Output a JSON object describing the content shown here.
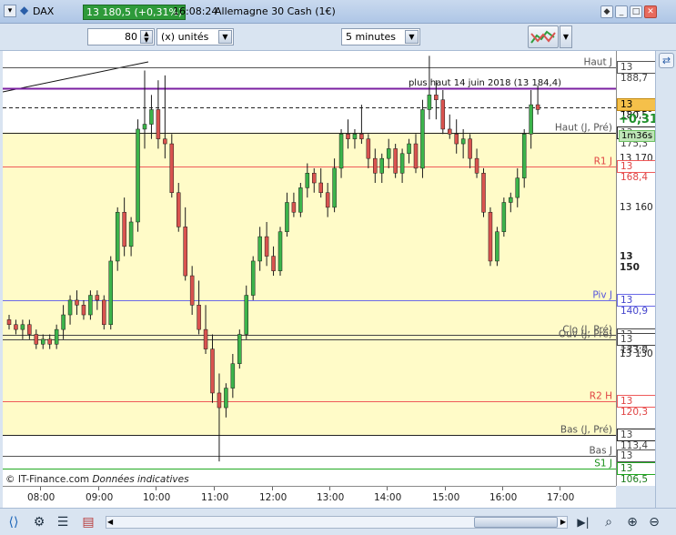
{
  "titlebar": {
    "symbol": "DAX",
    "price_change": "13 180,5 (+0,31%)",
    "time": "16:08:24",
    "instrument": "Allemagne 30 Cash (1€)"
  },
  "toolbar": {
    "units_value": "80",
    "units_label": "(x) unités",
    "timeframe": "5 minutes"
  },
  "chart": {
    "high_note": "plus haut 14 juin 2018 (13 184,4)",
    "source": "© IT-Finance.com",
    "disclaimer": "Données indicatives",
    "lines": [
      {
        "label": "Haut J",
        "value": 13188.7,
        "box": "13 188,7",
        "color": "#555555",
        "text_color": "#555555"
      },
      {
        "label": "",
        "value": 13184.4,
        "box": "",
        "color": "#7b1fa2",
        "text_color": "#7b1fa2"
      },
      {
        "label": "Haut (J, Pré)",
        "value": 13175.3,
        "box": "13 175,3",
        "color": "#222222",
        "text_color": "#555555"
      },
      {
        "label": "R1 J",
        "value": 13168.4,
        "box": "13 168,4",
        "color": "#ef5a5a",
        "text_color": "#e04444"
      },
      {
        "label": "Piv J",
        "value": 13140.9,
        "box": "13 140,9",
        "color": "#6a6ae8",
        "text_color": "#5555dd"
      },
      {
        "label": "Clo (J, Pré)",
        "value": 13134.0,
        "box": "13 134,0",
        "color": "#444444",
        "text_color": "#555555"
      },
      {
        "label": "Ouv (J, Pré)",
        "value": 13133.0,
        "box": "13 133,0",
        "color": "#444444",
        "text_color": "#555555"
      },
      {
        "label": "R2 H",
        "value": 13120.3,
        "box": "13 120,3",
        "color": "#ef5a5a",
        "text_color": "#e04444"
      },
      {
        "label": "Bas (J, Pré)",
        "value": 13113.4,
        "box": "13 113,4",
        "color": "#222222",
        "text_color": "#555555"
      },
      {
        "label": "Bas J",
        "value": 13109.2,
        "box": "13 109,2",
        "color": "#555555",
        "text_color": "#555555"
      },
      {
        "label": "S1 J",
        "value": 13106.5,
        "box": "13 106,5",
        "color": "#22aa22",
        "text_color": "#1a8f1a"
      }
    ],
    "current_price_box": "13 180,5",
    "change_pct": "+0,31%",
    "countdown": "1m36s",
    "y_ticks": [
      "13 180",
      "13 170",
      "13 160",
      "13 150",
      "13 130"
    ],
    "x_ticks": [
      "08:00",
      "09:00",
      "10:00",
      "11:00",
      "12:00",
      "13:00",
      "14:00",
      "15:00",
      "16:00",
      "17:00"
    ],
    "colors": {
      "up": "#3cb44b",
      "down": "#d9534f",
      "session_bg": "#fffbc8",
      "current_price": "#f5c04a"
    }
  },
  "chart_data": {
    "type": "candlestick",
    "y_range": [
      13103,
      13192
    ],
    "x_ticks": [
      "08:00",
      "09:00",
      "10:00",
      "11:00",
      "12:00",
      "13:00",
      "14:00",
      "15:00",
      "16:00",
      "17:00"
    ],
    "candles": [
      {
        "o": 13137,
        "h": 13138,
        "l": 13135,
        "c": 13136
      },
      {
        "o": 13136,
        "h": 13137,
        "l": 13134,
        "c": 13135
      },
      {
        "o": 13135,
        "h": 13137,
        "l": 13133,
        "c": 13136
      },
      {
        "o": 13136,
        "h": 13137,
        "l": 13133,
        "c": 13134
      },
      {
        "o": 13134,
        "h": 13135,
        "l": 13131,
        "c": 13132
      },
      {
        "o": 13132,
        "h": 13134,
        "l": 13131,
        "c": 13133
      },
      {
        "o": 13133,
        "h": 13134,
        "l": 13131,
        "c": 13132
      },
      {
        "o": 13132,
        "h": 13136,
        "l": 13131,
        "c": 13135
      },
      {
        "o": 13135,
        "h": 13140,
        "l": 13133,
        "c": 13138
      },
      {
        "o": 13138,
        "h": 13142,
        "l": 13136,
        "c": 13141
      },
      {
        "o": 13141,
        "h": 13143,
        "l": 13138,
        "c": 13140
      },
      {
        "o": 13140,
        "h": 13141,
        "l": 13137,
        "c": 13138
      },
      {
        "o": 13138,
        "h": 13143,
        "l": 13137,
        "c": 13142
      },
      {
        "o": 13142,
        "h": 13143,
        "l": 13139,
        "c": 13141
      },
      {
        "o": 13141,
        "h": 13142,
        "l": 13135,
        "c": 13136
      },
      {
        "o": 13136,
        "h": 13150,
        "l": 13135,
        "c": 13149
      },
      {
        "o": 13149,
        "h": 13160,
        "l": 13147,
        "c": 13159
      },
      {
        "o": 13159,
        "h": 13162,
        "l": 13150,
        "c": 13152
      },
      {
        "o": 13152,
        "h": 13158,
        "l": 13150,
        "c": 13157
      },
      {
        "o": 13157,
        "h": 13178,
        "l": 13155,
        "c": 13176
      },
      {
        "o": 13176,
        "h": 13188,
        "l": 13172,
        "c": 13177
      },
      {
        "o": 13177,
        "h": 13183,
        "l": 13174,
        "c": 13180
      },
      {
        "o": 13180,
        "h": 13186,
        "l": 13172,
        "c": 13174
      },
      {
        "o": 13174,
        "h": 13187,
        "l": 13170,
        "c": 13173
      },
      {
        "o": 13173,
        "h": 13175,
        "l": 13162,
        "c": 13163
      },
      {
        "o": 13163,
        "h": 13165,
        "l": 13155,
        "c": 13156
      },
      {
        "o": 13156,
        "h": 13160,
        "l": 13145,
        "c": 13146
      },
      {
        "o": 13146,
        "h": 13148,
        "l": 13138,
        "c": 13140
      },
      {
        "o": 13140,
        "h": 13145,
        "l": 13134,
        "c": 13135
      },
      {
        "o": 13135,
        "h": 13140,
        "l": 13130,
        "c": 13131
      },
      {
        "o": 13131,
        "h": 13134,
        "l": 13120,
        "c": 13122
      },
      {
        "o": 13122,
        "h": 13126,
        "l": 13108,
        "c": 13119
      },
      {
        "o": 13119,
        "h": 13124,
        "l": 13117,
        "c": 13123
      },
      {
        "o": 13123,
        "h": 13130,
        "l": 13121,
        "c": 13128
      },
      {
        "o": 13128,
        "h": 13135,
        "l": 13127,
        "c": 13134
      },
      {
        "o": 13134,
        "h": 13144,
        "l": 13133,
        "c": 13142
      },
      {
        "o": 13142,
        "h": 13150,
        "l": 13141,
        "c": 13149
      },
      {
        "o": 13149,
        "h": 13156,
        "l": 13147,
        "c": 13154
      },
      {
        "o": 13154,
        "h": 13157,
        "l": 13148,
        "c": 13150
      },
      {
        "o": 13150,
        "h": 13152,
        "l": 13146,
        "c": 13147
      },
      {
        "o": 13147,
        "h": 13156,
        "l": 13146,
        "c": 13155
      },
      {
        "o": 13155,
        "h": 13163,
        "l": 13154,
        "c": 13161
      },
      {
        "o": 13161,
        "h": 13163,
        "l": 13158,
        "c": 13159
      },
      {
        "o": 13159,
        "h": 13165,
        "l": 13158,
        "c": 13164
      },
      {
        "o": 13164,
        "h": 13169,
        "l": 13162,
        "c": 13167
      },
      {
        "o": 13167,
        "h": 13168,
        "l": 13163,
        "c": 13165
      },
      {
        "o": 13165,
        "h": 13168,
        "l": 13162,
        "c": 13163
      },
      {
        "o": 13163,
        "h": 13165,
        "l": 13158,
        "c": 13160
      },
      {
        "o": 13160,
        "h": 13170,
        "l": 13159,
        "c": 13168
      },
      {
        "o": 13168,
        "h": 13176,
        "l": 13166,
        "c": 13175
      },
      {
        "o": 13175,
        "h": 13178,
        "l": 13172,
        "c": 13174
      },
      {
        "o": 13174,
        "h": 13176,
        "l": 13172,
        "c": 13175
      },
      {
        "o": 13175,
        "h": 13181,
        "l": 13173,
        "c": 13174
      },
      {
        "o": 13174,
        "h": 13175,
        "l": 13168,
        "c": 13170
      },
      {
        "o": 13170,
        "h": 13172,
        "l": 13165,
        "c": 13167
      },
      {
        "o": 13167,
        "h": 13171,
        "l": 13165,
        "c": 13170
      },
      {
        "o": 13170,
        "h": 13174,
        "l": 13168,
        "c": 13172
      },
      {
        "o": 13172,
        "h": 13173,
        "l": 13166,
        "c": 13167
      },
      {
        "o": 13167,
        "h": 13172,
        "l": 13165,
        "c": 13171
      },
      {
        "o": 13171,
        "h": 13174,
        "l": 13169,
        "c": 13173
      },
      {
        "o": 13173,
        "h": 13175,
        "l": 13167,
        "c": 13168
      },
      {
        "o": 13168,
        "h": 13182,
        "l": 13166,
        "c": 13180
      },
      {
        "o": 13180,
        "h": 13191,
        "l": 13178,
        "c": 13183
      },
      {
        "o": 13183,
        "h": 13186,
        "l": 13178,
        "c": 13182
      },
      {
        "o": 13182,
        "h": 13184,
        "l": 13175,
        "c": 13176
      },
      {
        "o": 13176,
        "h": 13179,
        "l": 13174,
        "c": 13175
      },
      {
        "o": 13175,
        "h": 13178,
        "l": 13171,
        "c": 13173
      },
      {
        "o": 13173,
        "h": 13176,
        "l": 13170,
        "c": 13174
      },
      {
        "o": 13174,
        "h": 13175,
        "l": 13168,
        "c": 13170
      },
      {
        "o": 13170,
        "h": 13172,
        "l": 13166,
        "c": 13167
      },
      {
        "o": 13167,
        "h": 13168,
        "l": 13158,
        "c": 13159
      },
      {
        "o": 13159,
        "h": 13160,
        "l": 13148,
        "c": 13149
      },
      {
        "o": 13149,
        "h": 13156,
        "l": 13148,
        "c": 13155
      },
      {
        "o": 13155,
        "h": 13162,
        "l": 13154,
        "c": 13161
      },
      {
        "o": 13161,
        "h": 13163,
        "l": 13159,
        "c": 13162
      },
      {
        "o": 13162,
        "h": 13168,
        "l": 13160,
        "c": 13166
      },
      {
        "o": 13166,
        "h": 13176,
        "l": 13164,
        "c": 13175
      },
      {
        "o": 13175,
        "h": 13184,
        "l": 13172,
        "c": 13181
      },
      {
        "o": 13181,
        "h": 13185,
        "l": 13179,
        "c": 13180
      }
    ]
  },
  "icons": [
    "share-icon",
    "settings-icon",
    "list-icon",
    "grid-icon",
    "arrow-left-icon",
    "arrow-right-icon",
    "zoom-fit-icon",
    "zoom-in-icon",
    "zoom-out-icon",
    "zoom-reset-icon",
    "indicator-icon",
    "sync-icon"
  ]
}
